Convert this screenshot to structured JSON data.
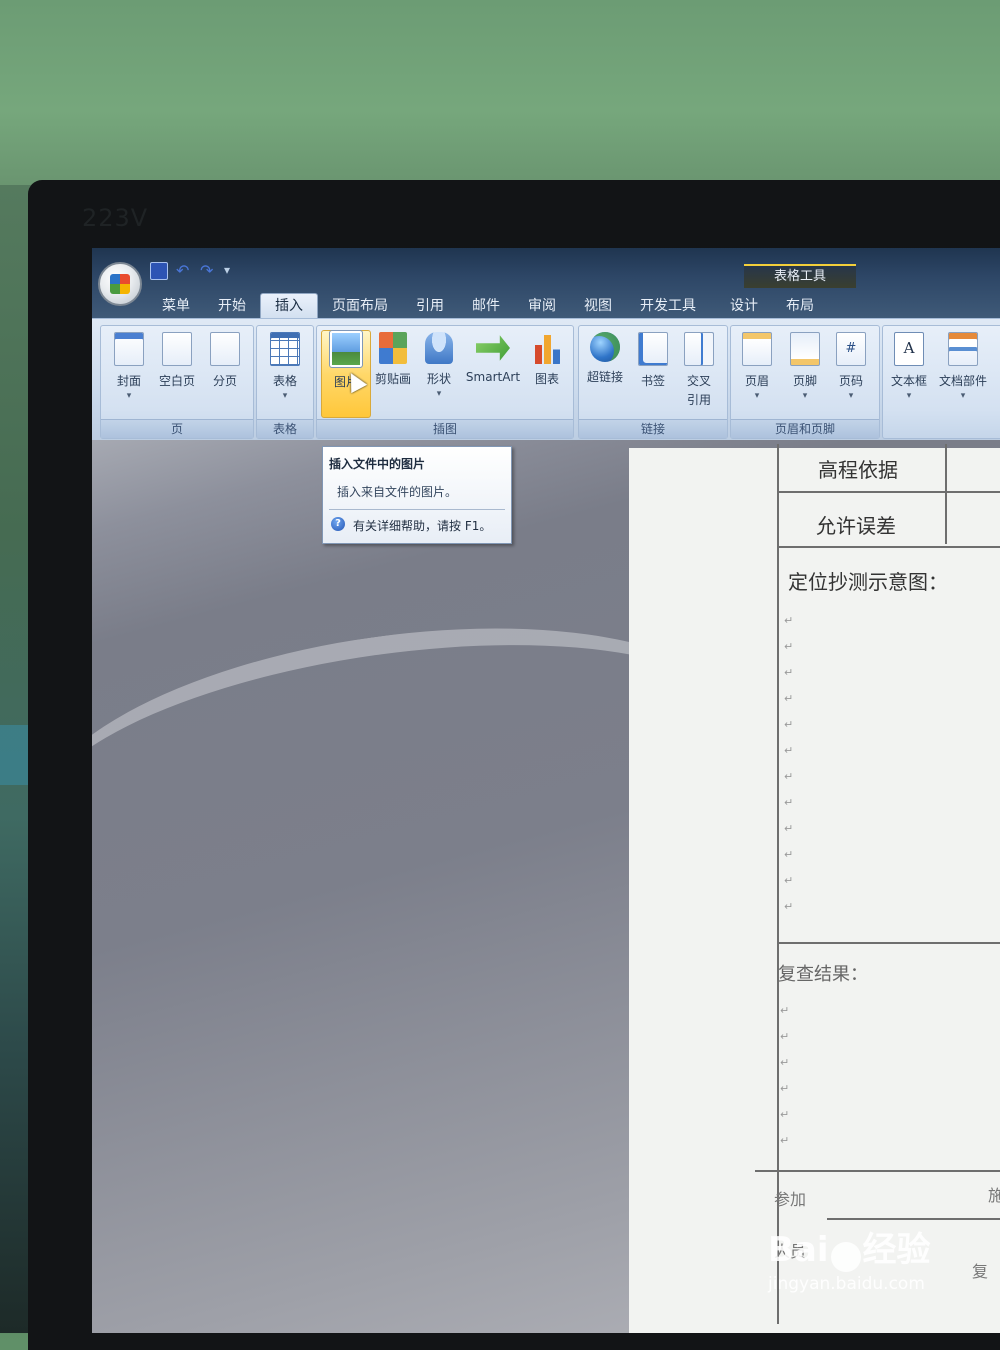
{
  "monitor": {
    "brand": "223V"
  },
  "quick_access": {
    "save": "save-icon",
    "undo": "undo-icon",
    "redo": "redo-icon",
    "more": "▾"
  },
  "context_tab_title": "表格工具",
  "tabs": [
    {
      "label": "菜单"
    },
    {
      "label": "开始"
    },
    {
      "label": "插入",
      "active": true
    },
    {
      "label": "页面布局"
    },
    {
      "label": "引用"
    },
    {
      "label": "邮件"
    },
    {
      "label": "审阅"
    },
    {
      "label": "视图"
    },
    {
      "label": "开发工具"
    },
    {
      "label": "设计"
    },
    {
      "label": "布局"
    }
  ],
  "ribbon": {
    "groups": {
      "pages": {
        "label": "页",
        "buttons": [
          "封面",
          "空白页",
          "分页"
        ]
      },
      "tables": {
        "label": "表格",
        "buttons": [
          "表格"
        ]
      },
      "illustrations": {
        "label": "插图",
        "buttons": [
          "图片",
          "剪贴画",
          "形状",
          "SmartArt",
          "图表"
        ]
      },
      "links": {
        "label": "链接",
        "buttons": [
          "超链接",
          "书签",
          "交叉",
          "引用"
        ]
      },
      "header_footer": {
        "label": "页眉和页脚",
        "buttons": [
          "页眉",
          "页脚",
          "页码"
        ]
      },
      "text": {
        "buttons": [
          "文本框",
          "文档部件"
        ]
      }
    },
    "picture_visible_text": "图片"
  },
  "tooltip": {
    "title": "插入文件中的图片",
    "description": "插入来自文件的图片。",
    "help": "有关详细帮助，请按 F1。"
  },
  "document": {
    "rows": {
      "elevation_basis": "高程依据",
      "tolerance": "允许误差",
      "diagram": "定位抄测示意图：",
      "recheck": "复查结果：",
      "participants_1": "参加",
      "participants_2": "人员",
      "right_1": "施",
      "right_2": "复"
    },
    "para_mark": "↵"
  },
  "watermark": {
    "logo_text_1": "Bai",
    "logo_text_2": "经验",
    "url": "jingyan.baidu.com"
  }
}
